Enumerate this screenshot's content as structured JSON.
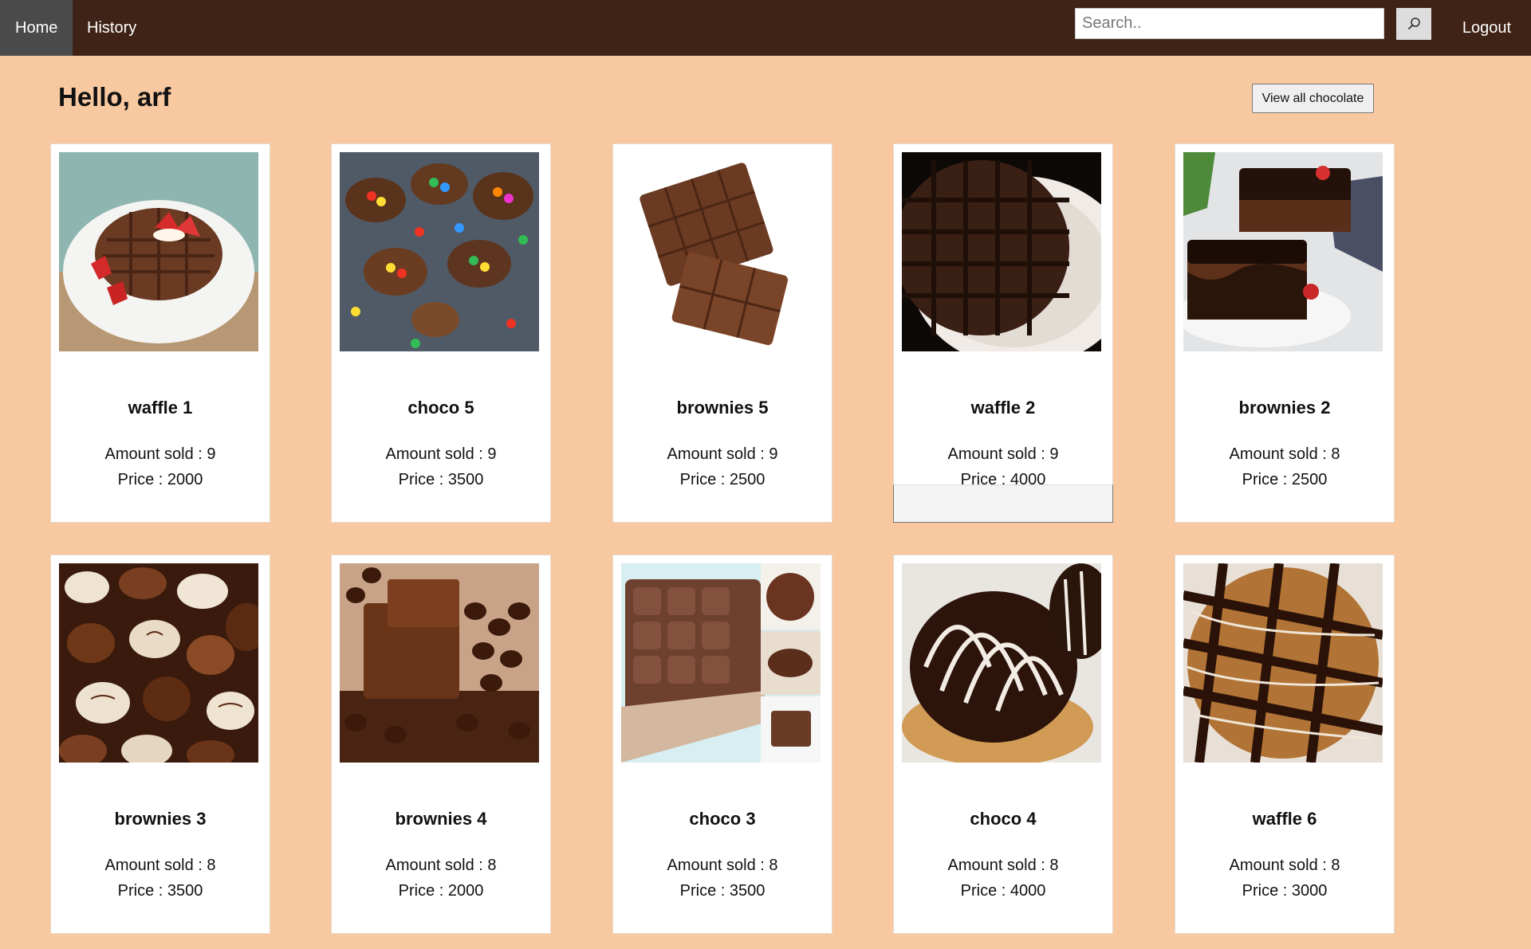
{
  "nav": {
    "home_label": "Home",
    "history_label": "History",
    "search_placeholder": "Search..",
    "logout_label": "Logout"
  },
  "header": {
    "greeting": "Hello, arf",
    "view_all_label": "View all chocolate"
  },
  "products": [
    {
      "name": "waffle 1",
      "sold": "Amount sold : 9",
      "price": "Price : 2000",
      "image": "waffle-strawberry-image"
    },
    {
      "name": "choco 5",
      "sold": "Amount sold : 9",
      "price": "Price : 3500",
      "image": "candy-eggs-image"
    },
    {
      "name": "brownies 5",
      "sold": "Amount sold : 9",
      "price": "Price : 2500",
      "image": "chocolate-bar-image"
    },
    {
      "name": "waffle 2",
      "sold": "Amount sold : 9",
      "price": "Price : 4000",
      "image": "chocolate-waffle-image"
    },
    {
      "name": "brownies 2",
      "sold": "Amount sold : 8",
      "price": "Price : 2500",
      "image": "brownie-cake-image"
    },
    {
      "name": "brownies 3",
      "sold": "Amount sold : 8",
      "price": "Price : 3500",
      "image": "pralines-image"
    },
    {
      "name": "brownies 4",
      "sold": "Amount sold : 8",
      "price": "Price : 2000",
      "image": "chocolate-beans-image"
    },
    {
      "name": "choco 3",
      "sold": "Amount sold : 8",
      "price": "Price : 3500",
      "image": "truffle-collage-image"
    },
    {
      "name": "choco 4",
      "sold": "Amount sold : 8",
      "price": "Price : 4000",
      "image": "striped-donut-image"
    },
    {
      "name": "waffle 6",
      "sold": "Amount sold : 8",
      "price": "Price : 3000",
      "image": "waffle-drizzle-image"
    }
  ],
  "colors": {
    "navbar": "#3f2316",
    "background": "#f8c9a0",
    "active_tab": "#4a4a4a"
  }
}
